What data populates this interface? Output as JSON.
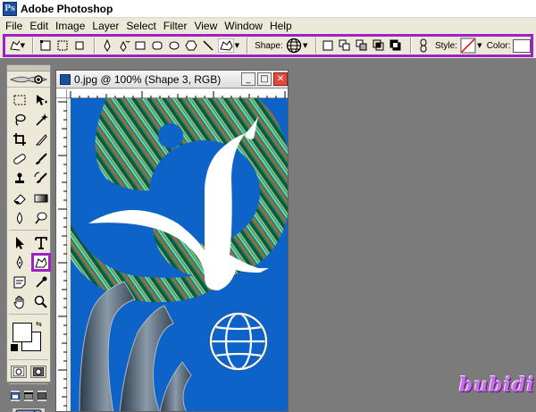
{
  "app": {
    "title": "Adobe Photoshop",
    "icon": "photoshop-app-icon"
  },
  "menu": [
    "File",
    "Edit",
    "Image",
    "Layer",
    "Select",
    "Filter",
    "View",
    "Window",
    "Help"
  ],
  "options_bar": {
    "shape_label": "Shape:",
    "style_label": "Style:",
    "color_label": "Color:",
    "highlight_color": "#a020c8",
    "shape_value": "globe-shape-icon",
    "color_value": "#ffffff"
  },
  "document": {
    "title": "0.jpg @ 100% (Shape 3, RGB)",
    "canvas_color": "#0d63c8"
  },
  "toolbox": {
    "active_tool": "custom-shape-tool",
    "foreground": "#ffffff",
    "background": "#ffffff"
  },
  "watermark": "bubidi"
}
